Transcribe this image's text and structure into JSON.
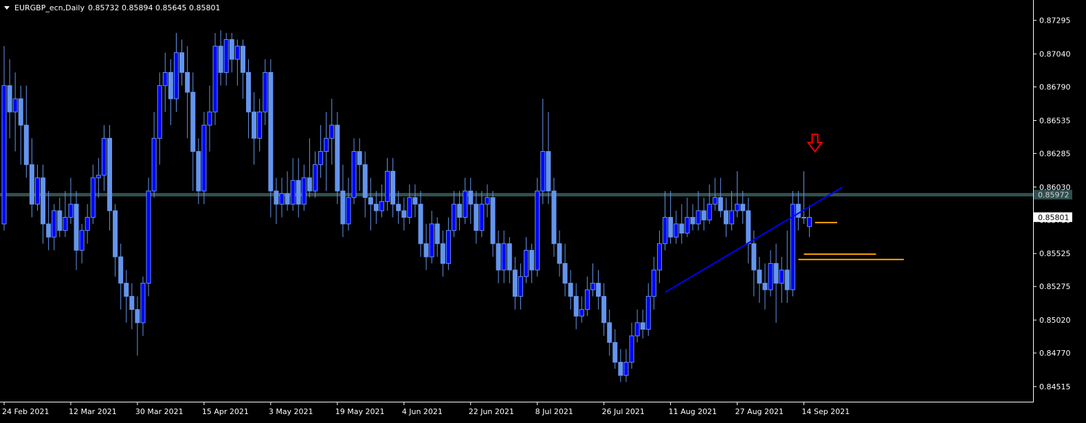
{
  "header": {
    "symbol_label": "EURGBP_ecn,Daily",
    "ohlc_label": "0.85732 0.85894 0.85645 0.85801"
  },
  "colors": {
    "background": "#000000",
    "bull_candle": "#0000ff",
    "bear_candle": "#6495ed",
    "wick": "#6495ed",
    "horizontal_line": "#2f4f4f",
    "trend_line": "#0000ff",
    "level_lines": "#ffa500",
    "arrow": "#ff0000",
    "axis": "#ffffff"
  },
  "chart_data": {
    "type": "candlestick",
    "instrument": "EURGBP_ecn",
    "timeframe": "Daily",
    "ylim": [
      0.844,
      0.8745
    ],
    "y_ticks": [
      "0.87295",
      "0.87040",
      "0.86790",
      "0.86535",
      "0.86285",
      "0.86030",
      "0.85780",
      "0.85525",
      "0.85275",
      "0.85020",
      "0.84770",
      "0.84515"
    ],
    "x_ticks": [
      "24 Feb 2021",
      "12 Mar 2021",
      "30 Mar 2021",
      "15 Apr 2021",
      "3 May 2021",
      "19 May 2021",
      "4 Jun 2021",
      "22 Jun 2021",
      "8 Jul 2021",
      "26 Jul 2021",
      "11 Aug 2021",
      "27 Aug 2021",
      "14 Sep 2021"
    ],
    "x_tick_index": [
      0,
      12,
      24,
      36,
      48,
      60,
      72,
      84,
      96,
      108,
      120,
      132,
      144
    ],
    "price_labels": [
      {
        "text": "0.85972",
        "value": 0.85972,
        "kind": "horizontal-line"
      },
      {
        "text": "0.85801",
        "value": 0.85801,
        "kind": "current-price"
      }
    ],
    "candles_approx": [
      [
        0.8575,
        0.868,
        0.871,
        0.857
      ],
      [
        0.868,
        0.866,
        0.87,
        0.864
      ],
      [
        0.866,
        0.867,
        0.869,
        0.863
      ],
      [
        0.867,
        0.865,
        0.868,
        0.862
      ],
      [
        0.865,
        0.862,
        0.868,
        0.861
      ],
      [
        0.862,
        0.859,
        0.864,
        0.858
      ],
      [
        0.859,
        0.861,
        0.862,
        0.8585
      ],
      [
        0.861,
        0.8575,
        0.862,
        0.856
      ],
      [
        0.8575,
        0.8565,
        0.86,
        0.8555
      ],
      [
        0.8565,
        0.8585,
        0.859,
        0.8555
      ],
      [
        0.8585,
        0.857,
        0.8595,
        0.8565
      ],
      [
        0.857,
        0.858,
        0.86,
        0.8565
      ],
      [
        0.858,
        0.859,
        0.861,
        0.8575
      ],
      [
        0.859,
        0.8555,
        0.86,
        0.854
      ],
      [
        0.8555,
        0.857,
        0.8575,
        0.8545
      ],
      [
        0.857,
        0.858,
        0.859,
        0.856
      ],
      [
        0.858,
        0.861,
        0.862,
        0.8575
      ],
      [
        0.861,
        0.8612,
        0.8625,
        0.8595
      ],
      [
        0.8612,
        0.864,
        0.865,
        0.86
      ],
      [
        0.864,
        0.8585,
        0.865,
        0.857
      ],
      [
        0.8585,
        0.855,
        0.859,
        0.8535
      ],
      [
        0.855,
        0.853,
        0.856,
        0.851
      ],
      [
        0.853,
        0.852,
        0.854,
        0.85
      ],
      [
        0.852,
        0.851,
        0.853,
        0.8495
      ],
      [
        0.851,
        0.85,
        0.852,
        0.8475
      ],
      [
        0.85,
        0.853,
        0.8535,
        0.849
      ],
      [
        0.853,
        0.86,
        0.861,
        0.852
      ],
      [
        0.86,
        0.864,
        0.866,
        0.8595
      ],
      [
        0.864,
        0.868,
        0.869,
        0.862
      ],
      [
        0.868,
        0.869,
        0.8705,
        0.866
      ],
      [
        0.869,
        0.867,
        0.87,
        0.865
      ],
      [
        0.867,
        0.8705,
        0.872,
        0.866
      ],
      [
        0.8705,
        0.869,
        0.8715,
        0.868
      ],
      [
        0.869,
        0.8675,
        0.871,
        0.864
      ],
      [
        0.8675,
        0.863,
        0.869,
        0.86
      ],
      [
        0.863,
        0.86,
        0.864,
        0.859
      ],
      [
        0.86,
        0.865,
        0.866,
        0.859
      ],
      [
        0.865,
        0.866,
        0.868,
        0.863
      ],
      [
        0.866,
        0.871,
        0.872,
        0.865
      ],
      [
        0.871,
        0.869,
        0.8722,
        0.868
      ],
      [
        0.869,
        0.8715,
        0.872,
        0.868
      ],
      [
        0.8715,
        0.87,
        0.872,
        0.869
      ],
      [
        0.87,
        0.871,
        0.8715,
        0.868
      ],
      [
        0.871,
        0.869,
        0.8715,
        0.867
      ],
      [
        0.869,
        0.866,
        0.87,
        0.864
      ],
      [
        0.866,
        0.864,
        0.8675,
        0.862
      ],
      [
        0.864,
        0.866,
        0.867,
        0.863
      ],
      [
        0.866,
        0.869,
        0.87,
        0.865
      ],
      [
        0.869,
        0.86,
        0.87,
        0.858
      ],
      [
        0.86,
        0.859,
        0.861,
        0.8575
      ],
      [
        0.859,
        0.8598,
        0.861,
        0.858
      ],
      [
        0.8598,
        0.859,
        0.8615,
        0.8585
      ],
      [
        0.859,
        0.8608,
        0.8625,
        0.8585
      ],
      [
        0.8608,
        0.859,
        0.8625,
        0.858
      ],
      [
        0.859,
        0.861,
        0.862,
        0.8585
      ],
      [
        0.861,
        0.86,
        0.864,
        0.8595
      ],
      [
        0.86,
        0.862,
        0.863,
        0.8595
      ],
      [
        0.862,
        0.863,
        0.865,
        0.861
      ],
      [
        0.863,
        0.864,
        0.866,
        0.86
      ],
      [
        0.864,
        0.865,
        0.867,
        0.862
      ],
      [
        0.865,
        0.86,
        0.866,
        0.859
      ],
      [
        0.86,
        0.8575,
        0.862,
        0.8565
      ],
      [
        0.8575,
        0.8595,
        0.861,
        0.857
      ],
      [
        0.8595,
        0.863,
        0.864,
        0.859
      ],
      [
        0.863,
        0.862,
        0.864,
        0.86
      ],
      [
        0.862,
        0.8595,
        0.863,
        0.858
      ],
      [
        0.8595,
        0.859,
        0.861,
        0.857
      ],
      [
        0.859,
        0.8585,
        0.86,
        0.8575
      ],
      [
        0.8585,
        0.8592,
        0.8605,
        0.858
      ],
      [
        0.8592,
        0.8615,
        0.8625,
        0.8585
      ],
      [
        0.8615,
        0.859,
        0.8625,
        0.858
      ],
      [
        0.859,
        0.8585,
        0.86,
        0.8575
      ],
      [
        0.8585,
        0.858,
        0.8595,
        0.857
      ],
      [
        0.858,
        0.8595,
        0.8605,
        0.8575
      ],
      [
        0.8595,
        0.859,
        0.8605,
        0.858
      ],
      [
        0.859,
        0.856,
        0.86,
        0.855
      ],
      [
        0.856,
        0.855,
        0.8575,
        0.854
      ],
      [
        0.855,
        0.8575,
        0.8585,
        0.8545
      ],
      [
        0.8575,
        0.856,
        0.858,
        0.855
      ],
      [
        0.856,
        0.8545,
        0.857,
        0.8535
      ],
      [
        0.8545,
        0.857,
        0.858,
        0.854
      ],
      [
        0.857,
        0.859,
        0.86,
        0.8565
      ],
      [
        0.859,
        0.858,
        0.86,
        0.857
      ],
      [
        0.858,
        0.86,
        0.861,
        0.8575
      ],
      [
        0.86,
        0.859,
        0.861,
        0.8575
      ],
      [
        0.859,
        0.857,
        0.86,
        0.856
      ],
      [
        0.857,
        0.859,
        0.86,
        0.8565
      ],
      [
        0.859,
        0.8595,
        0.8605,
        0.858
      ],
      [
        0.8595,
        0.856,
        0.86,
        0.855
      ],
      [
        0.856,
        0.854,
        0.857,
        0.853
      ],
      [
        0.854,
        0.856,
        0.857,
        0.853
      ],
      [
        0.856,
        0.854,
        0.8565,
        0.853
      ],
      [
        0.854,
        0.852,
        0.855,
        0.851
      ],
      [
        0.852,
        0.8535,
        0.8545,
        0.851
      ],
      [
        0.8535,
        0.8555,
        0.8565,
        0.853
      ],
      [
        0.8555,
        0.854,
        0.856,
        0.853
      ],
      [
        0.854,
        0.86,
        0.861,
        0.8535
      ],
      [
        0.86,
        0.863,
        0.867,
        0.859
      ],
      [
        0.863,
        0.86,
        0.866,
        0.859
      ],
      [
        0.86,
        0.856,
        0.861,
        0.855
      ],
      [
        0.856,
        0.8545,
        0.857,
        0.8535
      ],
      [
        0.8545,
        0.853,
        0.856,
        0.852
      ],
      [
        0.853,
        0.852,
        0.854,
        0.851
      ],
      [
        0.852,
        0.8505,
        0.853,
        0.8495
      ],
      [
        0.8505,
        0.851,
        0.852,
        0.85
      ],
      [
        0.851,
        0.8525,
        0.8535,
        0.8505
      ],
      [
        0.8525,
        0.853,
        0.8545,
        0.852
      ],
      [
        0.853,
        0.852,
        0.854,
        0.851
      ],
      [
        0.852,
        0.85,
        0.853,
        0.849
      ],
      [
        0.85,
        0.8485,
        0.851,
        0.8475
      ],
      [
        0.8485,
        0.847,
        0.8495,
        0.8465
      ],
      [
        0.847,
        0.846,
        0.848,
        0.8455
      ],
      [
        0.846,
        0.847,
        0.848,
        0.8455
      ],
      [
        0.847,
        0.849,
        0.85,
        0.8465
      ],
      [
        0.849,
        0.85,
        0.851,
        0.8485
      ],
      [
        0.85,
        0.8495,
        0.851,
        0.8488
      ],
      [
        0.8495,
        0.852,
        0.853,
        0.849
      ],
      [
        0.852,
        0.854,
        0.855,
        0.851
      ],
      [
        0.854,
        0.856,
        0.857,
        0.853
      ],
      [
        0.856,
        0.858,
        0.86,
        0.8555
      ],
      [
        0.858,
        0.8565,
        0.86,
        0.856
      ],
      [
        0.8565,
        0.8575,
        0.8585,
        0.856
      ],
      [
        0.8575,
        0.8568,
        0.859,
        0.856
      ],
      [
        0.8568,
        0.858,
        0.8595,
        0.8565
      ],
      [
        0.858,
        0.8575,
        0.859,
        0.857
      ],
      [
        0.8575,
        0.8585,
        0.86,
        0.857
      ],
      [
        0.8585,
        0.8578,
        0.8595,
        0.857
      ],
      [
        0.8578,
        0.859,
        0.8605,
        0.8575
      ],
      [
        0.859,
        0.8595,
        0.861,
        0.8585
      ],
      [
        0.8595,
        0.8585,
        0.861,
        0.858
      ],
      [
        0.8585,
        0.8575,
        0.8595,
        0.8565
      ],
      [
        0.8575,
        0.8585,
        0.86,
        0.857
      ],
      [
        0.8585,
        0.859,
        0.8615,
        0.858
      ],
      [
        0.859,
        0.8585,
        0.86,
        0.8575
      ],
      [
        0.8585,
        0.856,
        0.8595,
        0.8545
      ],
      [
        0.856,
        0.854,
        0.857,
        0.852
      ],
      [
        0.854,
        0.853,
        0.855,
        0.8515
      ],
      [
        0.853,
        0.8525,
        0.8545,
        0.851
      ],
      [
        0.8525,
        0.8545,
        0.8555,
        0.852
      ],
      [
        0.8545,
        0.853,
        0.856,
        0.85
      ],
      [
        0.853,
        0.854,
        0.855,
        0.8515
      ],
      [
        0.854,
        0.8525,
        0.857,
        0.8515
      ],
      [
        0.8525,
        0.859,
        0.86,
        0.852
      ],
      [
        0.859,
        0.858,
        0.86,
        0.857
      ],
      [
        0.858,
        0.858,
        0.8615,
        0.8575
      ],
      [
        0.8573,
        0.858,
        0.8589,
        0.8565
      ]
    ],
    "horizontal_line": {
      "value": 0.85972
    },
    "trend_line": {
      "from": [
        119,
        0.8523
      ],
      "to": [
        151,
        0.8603
      ]
    },
    "level_lines": [
      {
        "value": 0.8576,
        "from_index": 146,
        "to_index": 150
      },
      {
        "value": 0.8552,
        "from_index": 144,
        "to_index": 157
      },
      {
        "value": 0.8548,
        "from_index": 143,
        "to_index": 162
      }
    ],
    "arrow": {
      "index": 146,
      "value": 0.863,
      "direction": "down"
    }
  }
}
